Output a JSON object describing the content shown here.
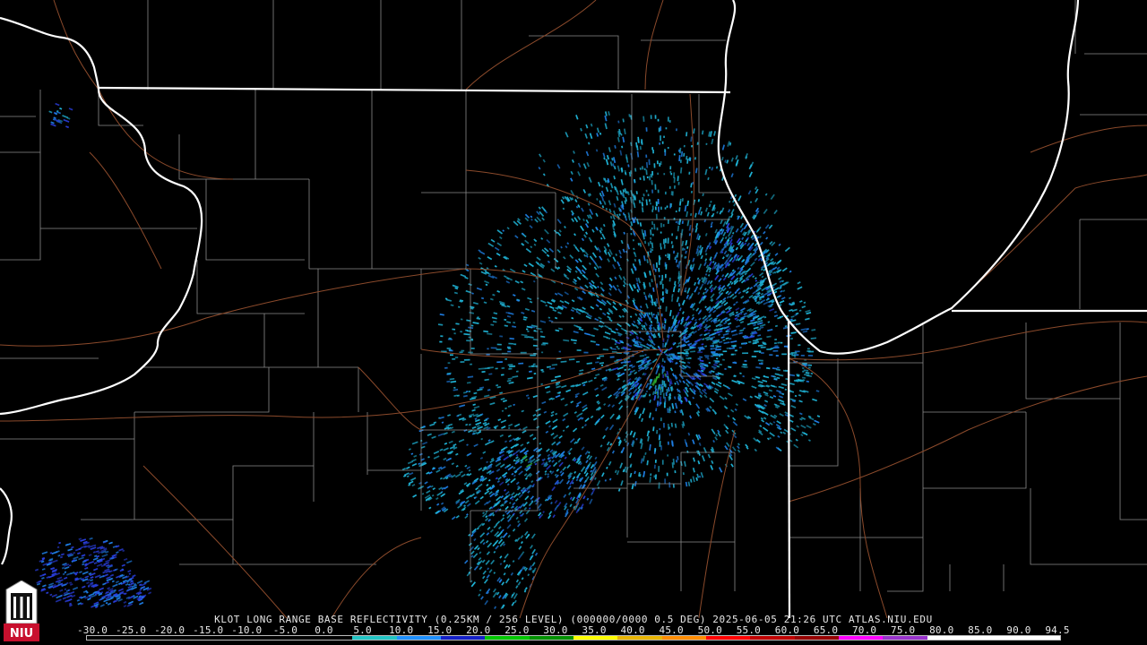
{
  "product_line": "KLOT LONG RANGE BASE REFLECTIVITY (0.25KM / 256 LEVEL) (000000/0000 0.5 DEG) 2025-06-05 21:26 UTC  ATLAS.NIU.EDU",
  "logo": {
    "text": "NIU",
    "icon": "niu-tower-logo-icon",
    "color": "#c8102e"
  },
  "colors": {
    "background": "#000000",
    "state_border": "#ffffff",
    "county_border": "#8a8a8a",
    "highway": "#8b4a2b",
    "echo_light": "#1fb5d8",
    "echo_mid": "#1e7fe6",
    "echo_strong": "#2a3fe0",
    "echo_green": "#2ea82e"
  },
  "scale": {
    "ticks": [
      "-30.0",
      "-25.0",
      "-20.0",
      "-15.0",
      "-10.0",
      "-5.0",
      "0.0",
      "5.0",
      "10.0",
      "15.0",
      "20.0",
      "25.0",
      "30.0",
      "35.0",
      "40.0",
      "45.0",
      "50.0",
      "55.0",
      "60.0",
      "65.0",
      "70.0",
      "75.0",
      "80.0",
      "85.0",
      "90.0",
      "94.5"
    ],
    "segment_colors": [
      "#000000",
      "#000000",
      "#000000",
      "#000000",
      "#000000",
      "#000000",
      "#22c4c4",
      "#1e90ff",
      "#1420c8",
      "#00c800",
      "#009100",
      "#ffff00",
      "#e8b400",
      "#ff8c00",
      "#ff0000",
      "#c00000",
      "#960000",
      "#ff00ff",
      "#9932cc",
      "#ffffff",
      "#ffffff",
      "#ffffff"
    ]
  }
}
